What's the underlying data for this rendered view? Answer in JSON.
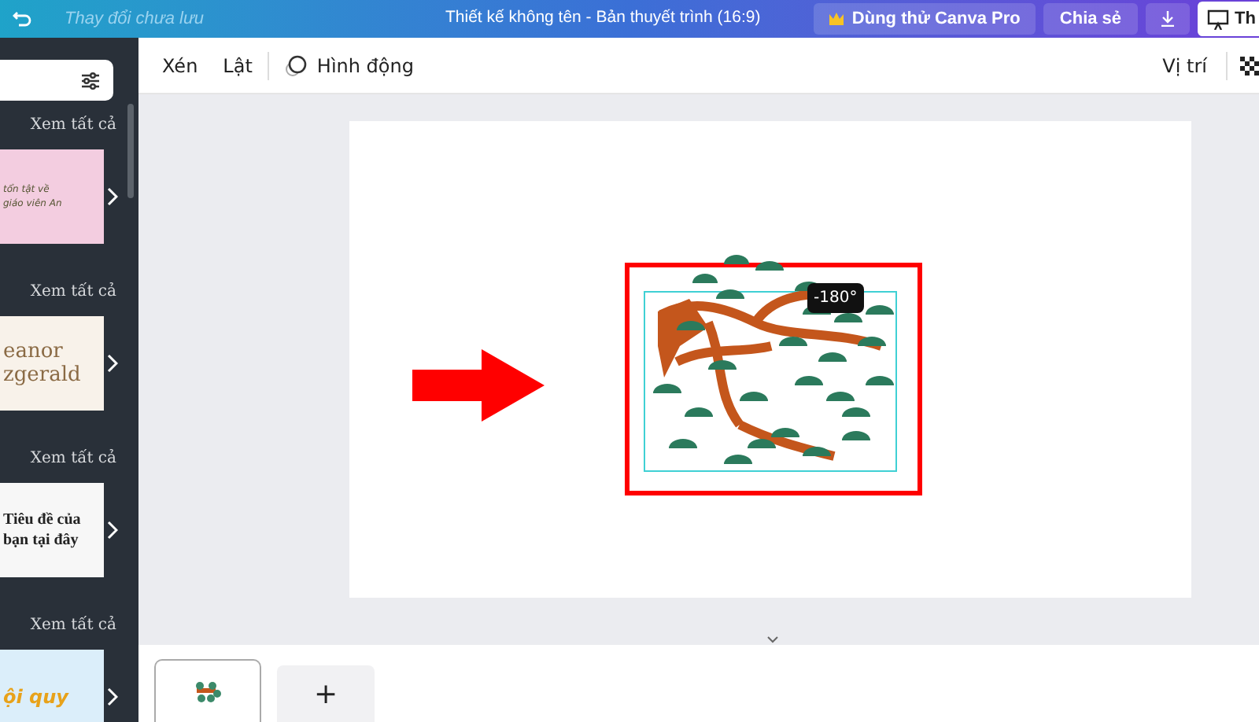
{
  "topbar": {
    "status": "Thay đổi chưa lưu",
    "title": "Thiết kế không tên - Bản thuyết trình (16:9)",
    "buttons": [
      {
        "kind": "pro",
        "label": "Dùng thử Canva Pro"
      },
      {
        "kind": "plain",
        "label": "Chia sẻ"
      },
      {
        "kind": "download"
      },
      {
        "kind": "present",
        "label": "Th"
      }
    ]
  },
  "toolbar": {
    "left": [
      "Xén",
      "Lật"
    ],
    "animate": "Hình động",
    "right": "Vị trí"
  },
  "sidebar": {
    "sections": [
      {
        "link": "Xem tất cả",
        "thumb": {
          "kind": "pink",
          "lines": [
            "tổn tật về",
            "giáo viên An"
          ]
        }
      },
      {
        "link": "Xem tất cả",
        "thumb": {
          "kind": "cream",
          "lines": [
            "eanor",
            "zgerald"
          ]
        }
      },
      {
        "link": "Xem tất cả",
        "thumb": {
          "kind": "white",
          "lines": [
            "Tiêu đề của",
            "bạn tại đây"
          ]
        }
      },
      {
        "link": "Xem tất cả",
        "thumb": {
          "kind": "yellow",
          "lines": [
            "ội quy"
          ]
        }
      }
    ]
  },
  "canvas": {
    "rotation": "-180°"
  },
  "pages": [
    {
      "kind": "page",
      "selected": true
    },
    {
      "kind": "add",
      "label": "+"
    }
  ]
}
